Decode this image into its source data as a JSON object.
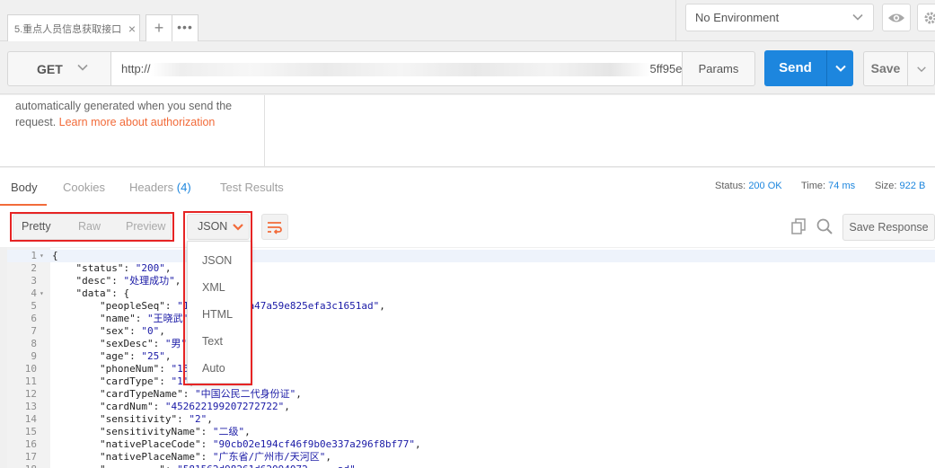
{
  "tabbar": {
    "tab_title": "5.重点人员信息获取接口",
    "add_label": "+",
    "more_label": "•••",
    "environment": "No Environment"
  },
  "request": {
    "method": "GET",
    "url_prefix": "http://",
    "url_suffix": "5ff95e...",
    "params_label": "Params",
    "send_label": "Send",
    "save_label": "Save"
  },
  "auth": {
    "text": "automatically generated when you send the request.",
    "link": "Learn more about authorization"
  },
  "response_tabs": {
    "body": "Body",
    "cookies": "Cookies",
    "headers": "Headers",
    "headers_count": "(4)",
    "test_results": "Test Results"
  },
  "response_meta": {
    "status_label": "Status:",
    "status_value": "200 OK",
    "time_label": "Time:",
    "time_value": "74 ms",
    "size_label": "Size:",
    "size_value": "922 B"
  },
  "toolbar": {
    "pretty": "Pretty",
    "raw": "Raw",
    "preview": "Preview",
    "format": "JSON",
    "save_response": "Save Response"
  },
  "format_dropdown": [
    "JSON",
    "XML",
    "HTML",
    "Text",
    "Auto"
  ],
  "code_lines": [
    {
      "n": "1",
      "fold": true,
      "text": "{"
    },
    {
      "n": "2",
      "fold": false,
      "text": "    \"status\": \"200\","
    },
    {
      "n": "3",
      "fold": false,
      "text": "    \"desc\": \"处理成功\","
    },
    {
      "n": "4",
      "fold": true,
      "text": "    \"data\": {"
    },
    {
      "n": "5",
      "fold": false,
      "text": "        \"peopleSeq\": \"1          a47a59e825efa3c1651ad\","
    },
    {
      "n": "6",
      "fold": false,
      "text": "        \"name\": \"王晓武\","
    },
    {
      "n": "7",
      "fold": false,
      "text": "        \"sex\": \"0\","
    },
    {
      "n": "8",
      "fold": false,
      "text": "        \"sexDesc\": \"男\","
    },
    {
      "n": "9",
      "fold": false,
      "text": "        \"age\": \"25\","
    },
    {
      "n": "10",
      "fold": false,
      "text": "        \"phoneNum\": \"15\","
    },
    {
      "n": "11",
      "fold": false,
      "text": "        \"cardType\": \"1\","
    },
    {
      "n": "12",
      "fold": false,
      "text": "        \"cardTypeName\": \"中国公民二代身份证\","
    },
    {
      "n": "13",
      "fold": false,
      "text": "        \"cardNum\": \"452622199207272722\","
    },
    {
      "n": "14",
      "fold": false,
      "text": "        \"sensitivity\": \"2\","
    },
    {
      "n": "15",
      "fold": false,
      "text": "        \"sensitivityName\": \"二级\","
    },
    {
      "n": "16",
      "fold": false,
      "text": "        \"nativePlaceCode\": \"90cb02e194cf46f9b0e337a296f8bf77\","
    },
    {
      "n": "17",
      "fold": false,
      "text": "        \"nativePlaceName\": \"广东省/广州市/天河区\","
    },
    {
      "n": "18",
      "fold": false,
      "text": "        \"         \": \"581562d98261d62094072     ad\""
    }
  ],
  "colors": {
    "send_blue": "#1d86de",
    "accent_orange": "#f26b3a",
    "annotation_red": "#e62424",
    "string_blue": "#1a1aa6"
  },
  "icons": [
    "close-icon",
    "chevron-down-icon",
    "eye-icon",
    "gear-icon",
    "wrap-lines-icon",
    "copy-icon",
    "search-icon"
  ]
}
